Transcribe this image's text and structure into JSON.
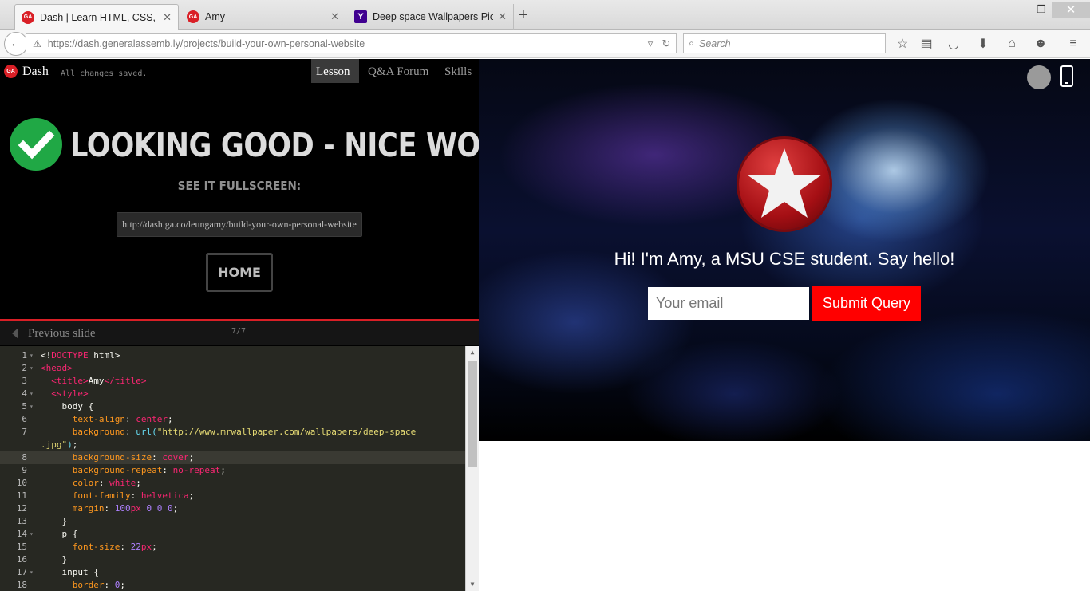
{
  "browser": {
    "tabs": [
      {
        "title": "Dash | Learn HTML, CSS, Ja...",
        "favicon": "GA",
        "active": true
      },
      {
        "title": "Amy",
        "favicon": "GA",
        "active": false
      },
      {
        "title": "Deep space Wallpapers Pic...",
        "favicon": "Y",
        "active": false
      }
    ],
    "new_tab": "+",
    "window": {
      "minimize": "‒",
      "restore": "❐",
      "close": "✕"
    },
    "url": "https://dash.generalassemb.ly/projects/build-your-own-personal-website",
    "search_placeholder": "Search",
    "toolbar_icons": [
      "bookmark-star-icon",
      "reading-list-icon",
      "pocket-icon",
      "download-icon",
      "home-icon",
      "smiley-icon",
      "menu-icon"
    ]
  },
  "dash": {
    "logo": "GA",
    "name": "Dash",
    "saved_status": "All changes saved.",
    "tabs": [
      "Lesson",
      "Q&A Forum",
      "Skills"
    ],
    "active_tab": "Lesson",
    "headline": "LOOKING GOOD - NICE WORK!",
    "see_fullscreen": "SEE IT FULLSCREEN:",
    "fullscreen_url": "http://dash.ga.co/leungamy/build-your-own-personal-website",
    "home_button": "HOME",
    "previous_slide": "Previous slide",
    "slide_counter": "7/7"
  },
  "code": {
    "highlighted_line": "8",
    "lines": [
      {
        "n": "1",
        "fold": "▾",
        "html": "<span class='p'>&lt;!</span><span class='k'>DOCTYPE</span><span class='p'> html&gt;</span>"
      },
      {
        "n": "2",
        "fold": "▾",
        "html": "<span class='k'>&lt;head&gt;</span>"
      },
      {
        "n": "3",
        "fold": "",
        "html": "  <span class='k'>&lt;title&gt;</span><span class='p'>Amy</span><span class='k'>&lt;/title&gt;</span>"
      },
      {
        "n": "4",
        "fold": "▾",
        "html": "  <span class='k'>&lt;style&gt;</span>"
      },
      {
        "n": "5",
        "fold": "▾",
        "html": "    <span class='p'>body {</span>"
      },
      {
        "n": "6",
        "fold": "",
        "html": "      <span class='a'>text-align</span><span class='p'>: </span><span class='k'>center</span><span class='p'>;</span>"
      },
      {
        "n": "7",
        "fold": "",
        "html": "      <span class='a'>background</span><span class='p'>: </span><span class='u'>url(</span><span class='s'>\"http://www.mrwallpaper.com/wallpapers/deep-space</span>"
      },
      {
        "n": "",
        "fold": "",
        "html": "<span class='s'>.jpg\"</span><span class='u'>)</span><span class='p'>;</span>"
      },
      {
        "n": "8",
        "fold": "",
        "html": "      <span class='a'>background-size</span><span class='p'>: </span><span class='k'>cover</span><span class='p'>;</span>"
      },
      {
        "n": "9",
        "fold": "",
        "html": "      <span class='a'>background-repeat</span><span class='p'>: </span><span class='k'>no-repeat</span><span class='p'>;</span>"
      },
      {
        "n": "10",
        "fold": "",
        "html": "      <span class='a'>color</span><span class='p'>: </span><span class='k'>white</span><span class='p'>;</span>"
      },
      {
        "n": "11",
        "fold": "",
        "html": "      <span class='a'>font-family</span><span class='p'>: </span><span class='k'>helvetica</span><span class='p'>;</span>"
      },
      {
        "n": "12",
        "fold": "",
        "html": "      <span class='a'>margin</span><span class='p'>: </span><span class='v'>100</span><span class='k'>px</span><span class='p'> </span><span class='v'>0 0 0</span><span class='p'>;</span>"
      },
      {
        "n": "13",
        "fold": "",
        "html": "    <span class='p'>}</span>"
      },
      {
        "n": "14",
        "fold": "▾",
        "html": "    <span class='p'>p {</span>"
      },
      {
        "n": "15",
        "fold": "",
        "html": "      <span class='a'>font-size</span><span class='p'>: </span><span class='v'>22</span><span class='k'>px</span><span class='p'>;</span>"
      },
      {
        "n": "16",
        "fold": "",
        "html": "    <span class='p'>}</span>"
      },
      {
        "n": "17",
        "fold": "▾",
        "html": "    <span class='p'>input {</span>"
      },
      {
        "n": "18",
        "fold": "",
        "html": "      <span class='a'>border</span><span class='p'>: </span><span class='v'>0</span><span class='p'>;</span>"
      }
    ]
  },
  "preview": {
    "greeting": "Hi! I'm Amy, a MSU CSE student. Say hello!",
    "email_placeholder": "Your email",
    "submit_label": "Submit Query",
    "colors": {
      "submit": "#ff0000",
      "logo_red": "#a50f14"
    }
  }
}
